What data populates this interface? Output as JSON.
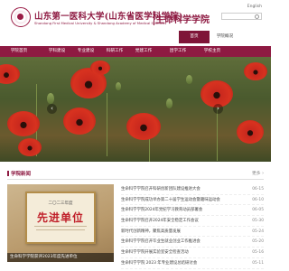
{
  "header": {
    "logo_cn": "山东第一医科大学(山东省医学科学院)",
    "logo_en": "Shandong First Medical University & Shandong Academy of Medical Sciences",
    "college_name": "生命科学学院",
    "lang_link": "English"
  },
  "subbar": {
    "items": [
      {
        "label": "首页"
      },
      {
        "label": "学院概况"
      }
    ]
  },
  "nav": {
    "items": [
      {
        "label": "学院首页"
      },
      {
        "label": "学科建设"
      },
      {
        "label": "专业建设"
      },
      {
        "label": "科研工作"
      },
      {
        "label": "党建工作"
      },
      {
        "label": "团学工作"
      },
      {
        "label": "学校主页"
      }
    ]
  },
  "banner": {
    "prev_label": "‹",
    "next_label": "›",
    "slide_count": 3,
    "active_slide": 1
  },
  "news": {
    "section_title": "学院新闻",
    "more_label": "更多 ›",
    "feature": {
      "year": "二〇二三年度",
      "title": "先进单位",
      "caption": "生命科学学院获评2023年度先进单位"
    },
    "items": [
      {
        "title": "生命科学学院召开科研创新团队建设推进大会",
        "date": "06-15"
      },
      {
        "title": "生命科学学院成功举办第二十届学生运动会暨趣味运动会",
        "date": "06-10"
      },
      {
        "title": "生命科学学院2024年党纪学习教育动员部署会",
        "date": "06-05"
      },
      {
        "title": "生命科学学院召开2024年安全稳定工作会议",
        "date": "05-30"
      },
      {
        "title": "新时代创新精神，聚焦高质量发展",
        "date": "05-24"
      },
      {
        "title": "生命科学学院召开毕业生就业创业工作推进会",
        "date": "05-20"
      },
      {
        "title": "生命科学学院开展实验室安全检查活动",
        "date": "05-16"
      },
      {
        "title": "生命科学学院 2023 年专业建设总结研讨会",
        "date": "05-11"
      }
    ]
  },
  "colors": {
    "brand": "#8e1a42",
    "nav_bg": "#8e1a42",
    "active_subbar": "#7f1538"
  }
}
